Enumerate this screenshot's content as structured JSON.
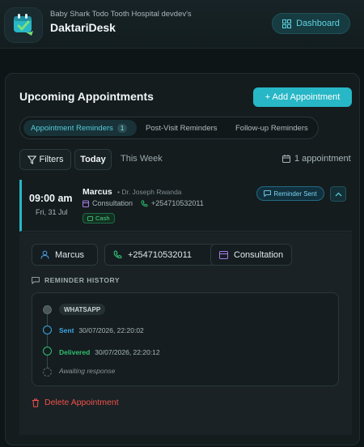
{
  "header": {
    "hospital_name": "Baby Shark Todo Tooth Hospital devdev's",
    "app_name": "DaktariDesk",
    "dashboard_label": "Dashboard"
  },
  "main": {
    "title": "Upcoming Appointments",
    "add_label": "+ Add Appointment",
    "tabs": [
      {
        "label": "Appointment Reminders",
        "count": "1",
        "active": true
      },
      {
        "label": "Post-Visit Reminders"
      },
      {
        "label": "Follow-up Reminders"
      }
    ],
    "filters_label": "Filters",
    "range_today": "Today",
    "range_week": "This Week",
    "appointment_count": "1 appointment"
  },
  "appointment": {
    "time": "09:00 am",
    "date": "Fri, 31 Jul",
    "patient": "Marcus",
    "doctor": "• Dr. Joseph Rwanda",
    "type": "Consultation",
    "phone": "+254710532011",
    "payment": "Cash",
    "status": "Reminder Sent"
  },
  "details": {
    "patient": "Marcus",
    "phone": "+254710532011",
    "type": "Consultation",
    "history_title": "REMINDER HISTORY",
    "channel": "WHATSAPP",
    "events": [
      {
        "label": "Sent",
        "time": "30/07/2026, 22:20:02"
      },
      {
        "label": "Delivered",
        "time": "30/07/2026, 22:20:12"
      },
      {
        "label": "Awaiting response"
      }
    ],
    "delete_label": "Delete Appointment"
  },
  "colors": {
    "accent": "#27b7c6",
    "sent": "#3ba7e0",
    "delivered": "#2fbf71",
    "danger": "#f0504a"
  }
}
